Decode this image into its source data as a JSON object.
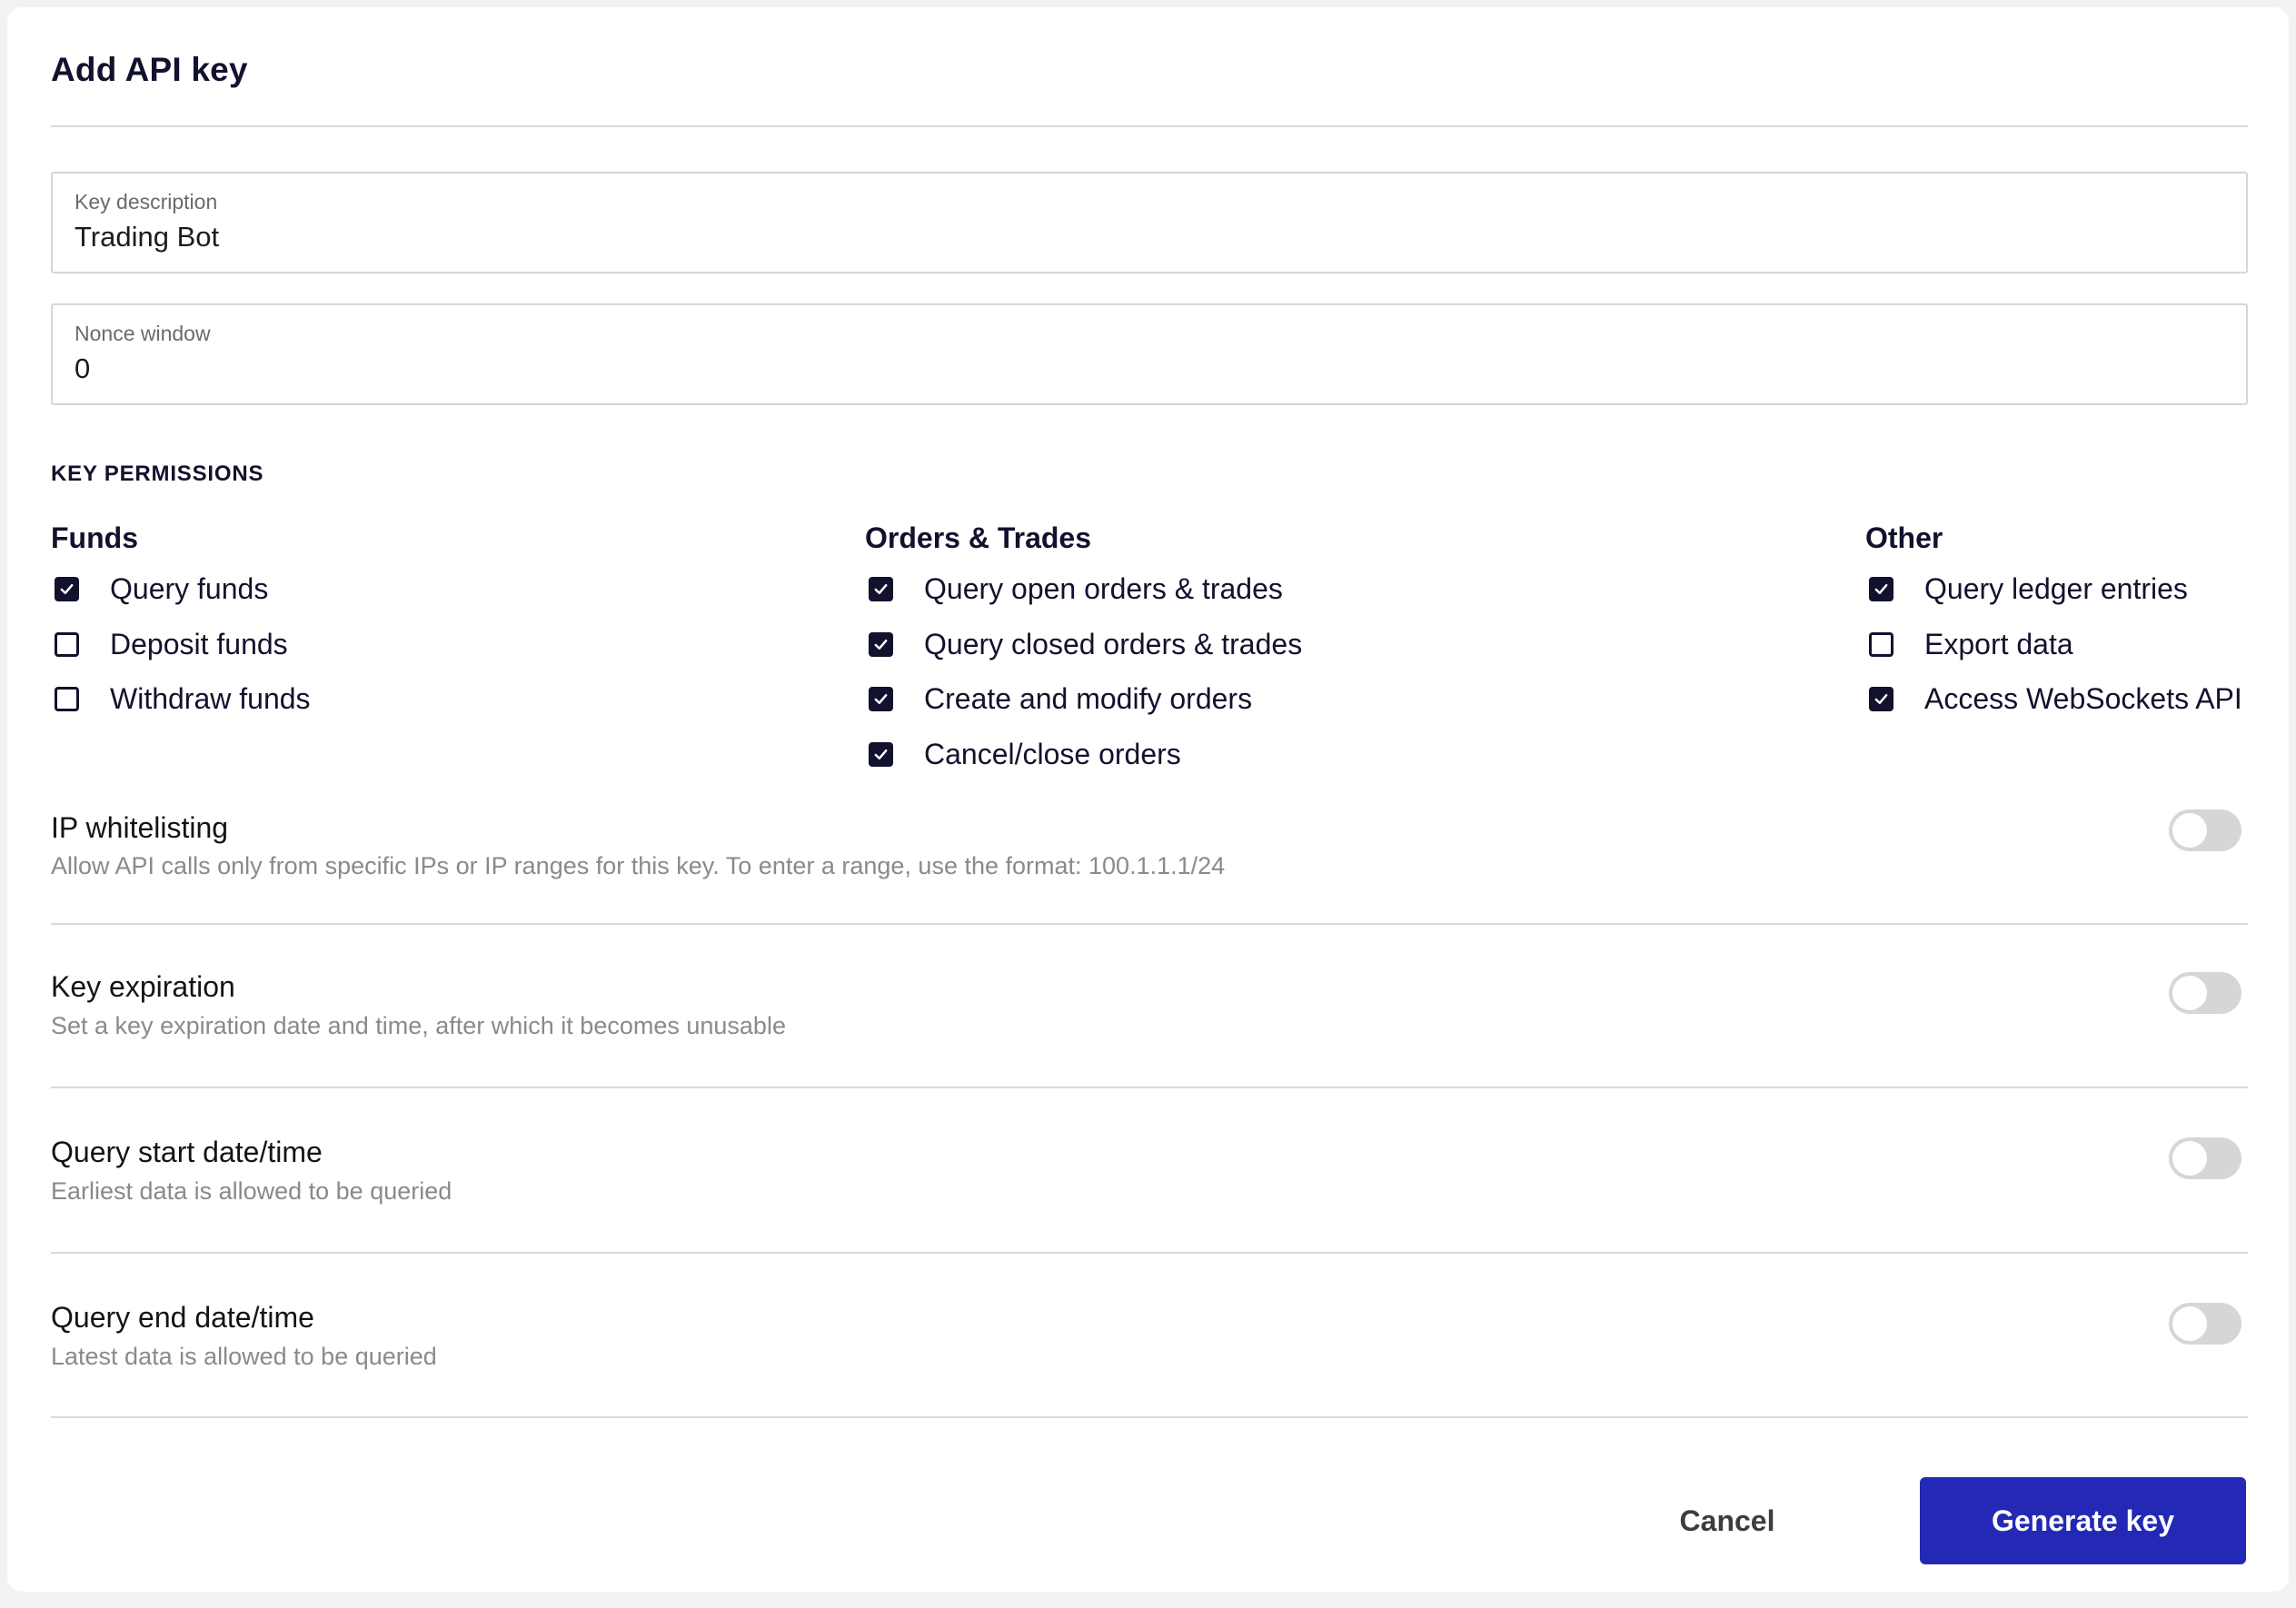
{
  "dialog": {
    "title": "Add API key"
  },
  "fields": {
    "key_description": {
      "label": "Key description",
      "value": "Trading Bot"
    },
    "nonce_window": {
      "label": "Nonce window",
      "value": "0"
    }
  },
  "permissions": {
    "section_label": "KEY PERMISSIONS",
    "groups": [
      {
        "title": "Funds",
        "items": [
          {
            "label": "Query funds",
            "checked": true
          },
          {
            "label": "Deposit funds",
            "checked": false
          },
          {
            "label": "Withdraw funds",
            "checked": false
          }
        ]
      },
      {
        "title": "Orders & Trades",
        "items": [
          {
            "label": "Query open orders & trades",
            "checked": true
          },
          {
            "label": "Query closed orders & trades",
            "checked": true
          },
          {
            "label": "Create and modify orders",
            "checked": true
          },
          {
            "label": "Cancel/close orders",
            "checked": true
          }
        ]
      },
      {
        "title": "Other",
        "items": [
          {
            "label": "Query ledger entries",
            "checked": true
          },
          {
            "label": "Export data",
            "checked": false
          },
          {
            "label": "Access WebSockets API",
            "checked": true
          }
        ]
      }
    ]
  },
  "options": [
    {
      "title": "IP whitelisting",
      "description": "Allow API calls only from specific IPs or IP ranges for this key. To enter a range, use the format: 100.1.1.1/24",
      "enabled": false
    },
    {
      "title": "Key expiration",
      "description": "Set a key expiration date and time, after which it becomes unusable",
      "enabled": false
    },
    {
      "title": "Query start date/time",
      "description": "Earliest data is allowed to be queried",
      "enabled": false
    },
    {
      "title": "Query end date/time",
      "description": "Latest data is allowed to be queried",
      "enabled": false
    }
  ],
  "actions": {
    "cancel_label": "Cancel",
    "generate_label": "Generate key"
  },
  "colors": {
    "primary": "#2329b5",
    "text_dark": "#12122e",
    "toggle_off": "#d6d6d6"
  }
}
